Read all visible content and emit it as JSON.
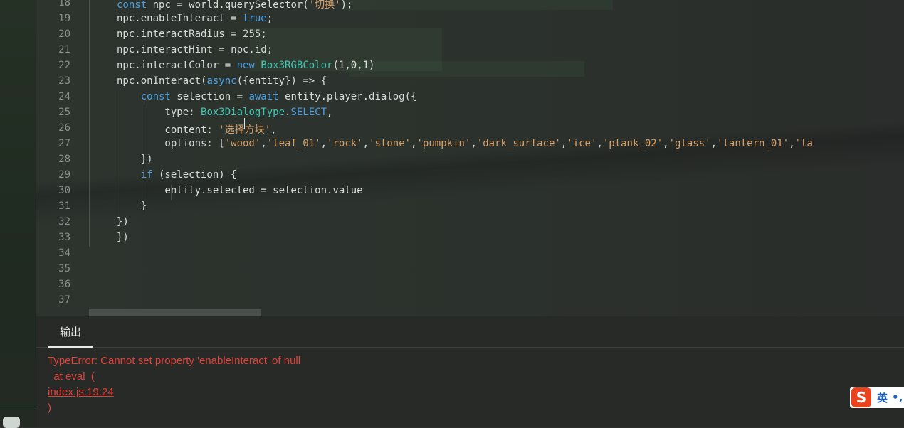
{
  "editor": {
    "lines": [
      {
        "num": "18",
        "tokens": [
          {
            "t": "const",
            "c": "kw"
          },
          {
            "t": " npc = world.querySelector(",
            "c": ""
          },
          {
            "t": "'切换'",
            "c": "str"
          },
          {
            "t": ");",
            "c": ""
          }
        ]
      },
      {
        "num": "19",
        "tokens": [
          {
            "t": "npc.enableInteract = ",
            "c": ""
          },
          {
            "t": "true",
            "c": "kw"
          },
          {
            "t": ";",
            "c": ""
          }
        ]
      },
      {
        "num": "20",
        "tokens": [
          {
            "t": "npc.interactRadius = ",
            "c": ""
          },
          {
            "t": "255",
            "c": "num"
          },
          {
            "t": ";",
            "c": ""
          }
        ]
      },
      {
        "num": "21",
        "tokens": [
          {
            "t": "npc.interactHint = npc.id;",
            "c": ""
          }
        ]
      },
      {
        "num": "22",
        "tokens": [
          {
            "t": "npc.interactColor = ",
            "c": ""
          },
          {
            "t": "new",
            "c": "kw"
          },
          {
            "t": " ",
            "c": ""
          },
          {
            "t": "Box3RGBColor",
            "c": "ty"
          },
          {
            "t": "(1,0,1)",
            "c": ""
          }
        ]
      },
      {
        "num": "23",
        "tokens": [
          {
            "t": "npc.onInteract(",
            "c": ""
          },
          {
            "t": "async",
            "c": "kw"
          },
          {
            "t": "({entity}) => {",
            "c": ""
          }
        ]
      },
      {
        "num": "24",
        "tokens": [
          {
            "t": "    ",
            "c": ""
          },
          {
            "t": "const",
            "c": "kw"
          },
          {
            "t": " selection = ",
            "c": ""
          },
          {
            "t": "await",
            "c": "kw"
          },
          {
            "t": " entity.player.dialog({",
            "c": ""
          }
        ]
      },
      {
        "num": "25",
        "tokens": [
          {
            "t": "        type: ",
            "c": ""
          },
          {
            "t": "Box3DialogType",
            "c": "ty"
          },
          {
            "t": ".",
            "c": ""
          },
          {
            "t": "SELECT",
            "c": "kw"
          },
          {
            "t": ",",
            "c": ""
          }
        ]
      },
      {
        "num": "26",
        "tokens": [
          {
            "t": "        content: ",
            "c": ""
          },
          {
            "t": "'选择方块'",
            "c": "str"
          },
          {
            "t": ",",
            "c": ""
          }
        ]
      },
      {
        "num": "27",
        "tokens": [
          {
            "t": "        options: [",
            "c": ""
          },
          {
            "t": "'wood'",
            "c": "str"
          },
          {
            "t": ",",
            "c": ""
          },
          {
            "t": "'leaf_01'",
            "c": "str"
          },
          {
            "t": ",",
            "c": ""
          },
          {
            "t": "'rock'",
            "c": "str"
          },
          {
            "t": ",",
            "c": ""
          },
          {
            "t": "'stone'",
            "c": "str"
          },
          {
            "t": ",",
            "c": ""
          },
          {
            "t": "'pumpkin'",
            "c": "str"
          },
          {
            "t": ",",
            "c": ""
          },
          {
            "t": "'dark_surface'",
            "c": "str"
          },
          {
            "t": ",",
            "c": ""
          },
          {
            "t": "'ice'",
            "c": "str"
          },
          {
            "t": ",",
            "c": ""
          },
          {
            "t": "'plank_02'",
            "c": "str"
          },
          {
            "t": ",",
            "c": ""
          },
          {
            "t": "'glass'",
            "c": "str"
          },
          {
            "t": ",",
            "c": ""
          },
          {
            "t": "'lantern_01'",
            "c": "str"
          },
          {
            "t": ",",
            "c": ""
          },
          {
            "t": "'la",
            "c": "str"
          }
        ]
      },
      {
        "num": "28",
        "tokens": [
          {
            "t": "    })",
            "c": ""
          }
        ]
      },
      {
        "num": "29",
        "tokens": [
          {
            "t": "    ",
            "c": ""
          },
          {
            "t": "if",
            "c": "kw"
          },
          {
            "t": " (selection) {",
            "c": ""
          }
        ]
      },
      {
        "num": "30",
        "tokens": [
          {
            "t": "        entity.selected = selection.value",
            "c": ""
          }
        ]
      },
      {
        "num": "31",
        "tokens": [
          {
            "t": "    }",
            "c": ""
          }
        ]
      },
      {
        "num": "32",
        "tokens": [
          {
            "t": "})",
            "c": ""
          }
        ]
      },
      {
        "num": "33",
        "tokens": [
          {
            "t": "})",
            "c": ""
          }
        ]
      },
      {
        "num": "34",
        "tokens": []
      },
      {
        "num": "35",
        "tokens": []
      },
      {
        "num": "36",
        "tokens": []
      },
      {
        "num": "37",
        "tokens": []
      }
    ]
  },
  "panel": {
    "tab_label": "输出",
    "error_line1": "TypeError: Cannot set property 'enableInteract' of null",
    "error_line2": "  at eval  (",
    "error_link": "index.js:19:24",
    "error_line4": ")"
  },
  "ime": {
    "logo": "S",
    "lang": "英",
    "punct": "•,"
  },
  "colors": {
    "keyword": "#4aa0e6",
    "type": "#3fc7b4",
    "string": "#d6a06a",
    "error": "#e0423a"
  }
}
